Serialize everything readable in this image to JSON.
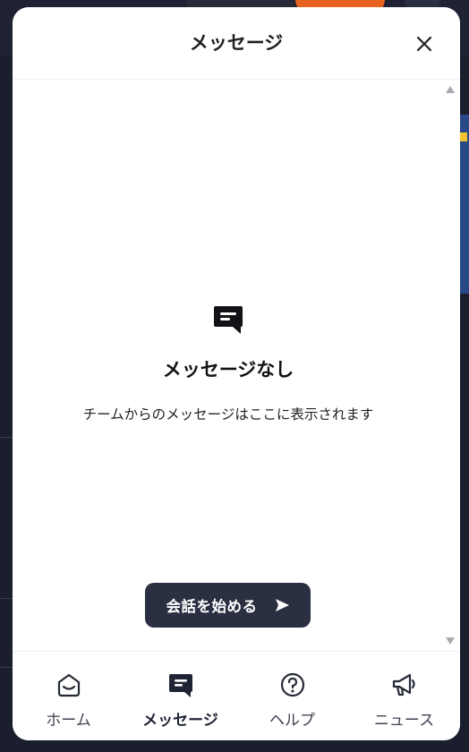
{
  "panel": {
    "title": "メッセージ",
    "close_icon": "close-icon"
  },
  "empty_state": {
    "icon": "message-icon",
    "title": "メッセージなし",
    "description": "チームからのメッセージはここに表示されます"
  },
  "start_button": {
    "label": "会話を始める",
    "icon": "send-icon"
  },
  "nav": {
    "items": [
      {
        "label": "ホーム",
        "icon": "home-icon",
        "active": false
      },
      {
        "label": "メッセージ",
        "icon": "messages-icon",
        "active": true
      },
      {
        "label": "ヘルプ",
        "icon": "help-icon",
        "active": false
      },
      {
        "label": "ニュース",
        "icon": "news-megaphone-icon",
        "active": false
      }
    ]
  },
  "colors": {
    "panel_bg": "#ffffff",
    "button_bg": "#2a3042",
    "text_primary": "#1f2024",
    "backdrop": "#1b1f2d"
  }
}
